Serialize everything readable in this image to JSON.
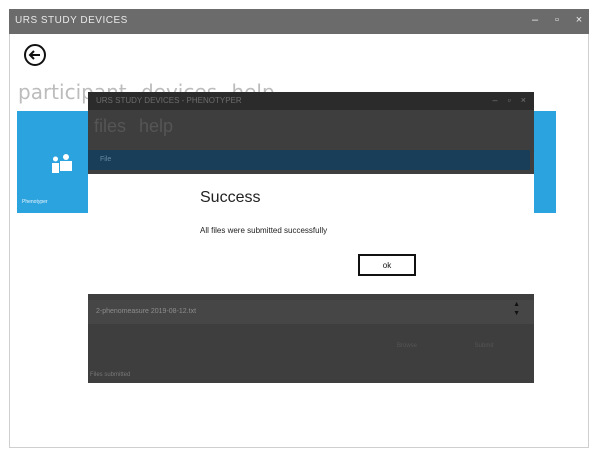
{
  "window": {
    "title": "URS STUDY DEVICES",
    "minimize": "–",
    "maximize": "▫",
    "close": "×"
  },
  "nav": {
    "items": [
      "participant",
      "devices",
      "help"
    ]
  },
  "tile": {
    "label": "Phenotyper",
    "color": "#2aa3de"
  },
  "overlay": {
    "title": "URS STUDY DEVICES - PHENOTYPER",
    "menu": [
      "files",
      "help"
    ],
    "selected_row": "File",
    "file_name": "2-phenomeasure 2019-08-12.txt",
    "browse_label": "Browse",
    "submit_label": "Submit",
    "status": "Files submitted"
  },
  "dialog": {
    "title": "Success",
    "message": "All files were submitted successfully",
    "ok_label": "ok"
  }
}
